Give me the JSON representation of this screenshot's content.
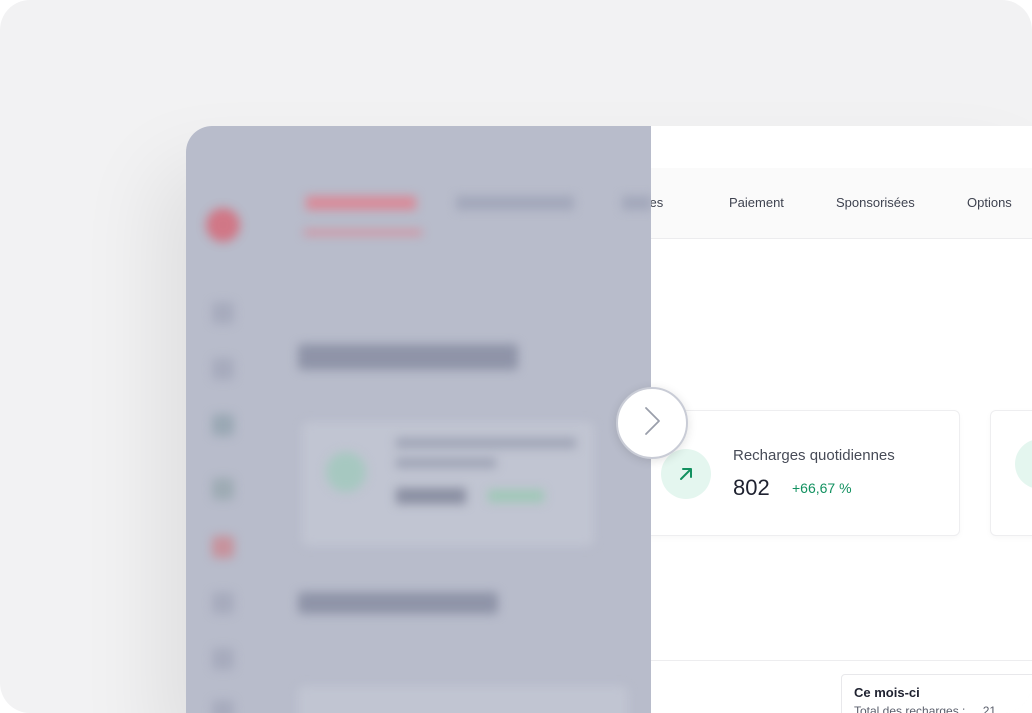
{
  "nav": {
    "tabs": [
      {
        "label": "Membres",
        "visible_fragment": "bres"
      },
      {
        "label": "Paiement"
      },
      {
        "label": "Sponsorisées"
      },
      {
        "label": "Options"
      }
    ]
  },
  "cards": [
    {
      "title": "Recharges quotidiennes",
      "value": "802",
      "delta": "+66,67 %",
      "icon": "arrow-up-right-icon"
    }
  ],
  "month_summary": {
    "title": "Ce mois-ci",
    "total_label": "Total des recharges :",
    "total_value": "21"
  },
  "comparison": {
    "handle_icon": "chevron-right-icon"
  },
  "colors": {
    "accent_green": "#129160",
    "icon_bg": "#e4f6ef",
    "overlay": "#b8bccb",
    "brand_red": "#e2455a"
  }
}
